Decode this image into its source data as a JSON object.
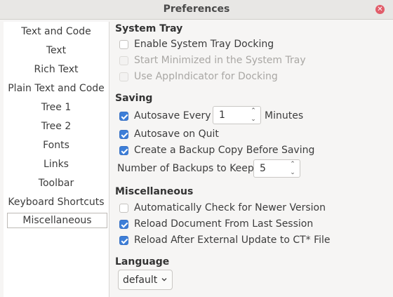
{
  "window": {
    "title": "Preferences"
  },
  "sidebar": {
    "items": [
      {
        "label": "Text and Code"
      },
      {
        "label": "Text"
      },
      {
        "label": "Rich Text"
      },
      {
        "label": "Plain Text and Code"
      },
      {
        "label": "Tree 1"
      },
      {
        "label": "Tree 2"
      },
      {
        "label": "Fonts"
      },
      {
        "label": "Links"
      },
      {
        "label": "Toolbar"
      },
      {
        "label": "Keyboard Shortcuts"
      },
      {
        "label": "Miscellaneous",
        "selected": true
      }
    ]
  },
  "system_tray": {
    "title": "System Tray",
    "enable_docking": {
      "label": "Enable System Tray Docking",
      "checked": false,
      "enabled": true
    },
    "start_minimized": {
      "label": "Start Minimized in the System Tray",
      "checked": false,
      "enabled": false
    },
    "use_appindicator": {
      "label": "Use AppIndicator for Docking",
      "checked": false,
      "enabled": false
    }
  },
  "saving": {
    "title": "Saving",
    "autosave_every": {
      "label": "Autosave Every",
      "checked": true,
      "value": "1",
      "unit": "Minutes"
    },
    "autosave_on_quit": {
      "label": "Autosave on Quit",
      "checked": true
    },
    "backup_copy": {
      "label": "Create a Backup Copy Before Saving",
      "checked": true
    },
    "num_backups": {
      "label": "Number of Backups to Keep",
      "value": "5"
    }
  },
  "misc": {
    "title": "Miscellaneous",
    "check_newer": {
      "label": "Automatically Check for Newer Version",
      "checked": false
    },
    "reload_last_session": {
      "label": "Reload Document From Last Session",
      "checked": true
    },
    "reload_after_update": {
      "label": "Reload After External Update to CT* File",
      "checked": true
    }
  },
  "language": {
    "title": "Language",
    "selected": "default"
  },
  "colors": {
    "accent": "#3d7ed8",
    "close": "#e15d6a"
  }
}
